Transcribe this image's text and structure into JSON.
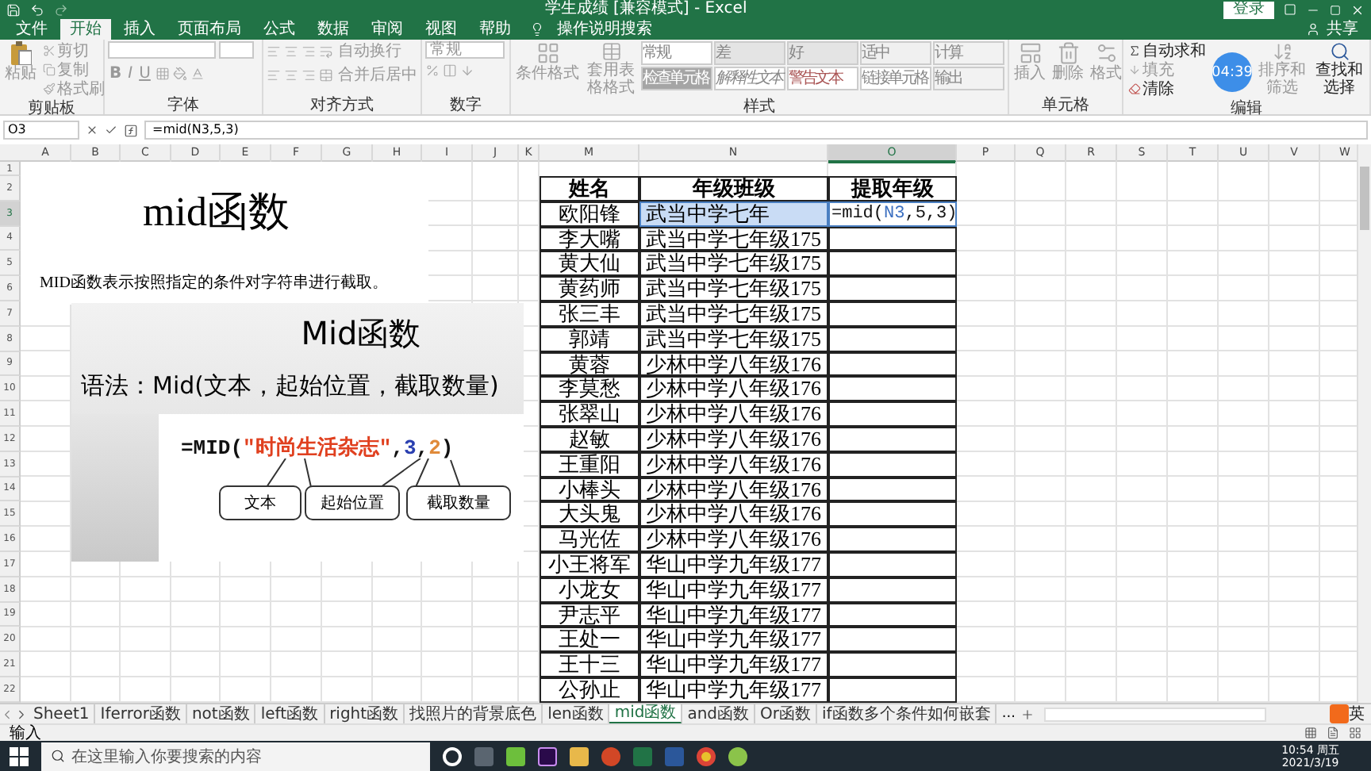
{
  "title_bar": {
    "title": "学生成绩 [兼容模式] - Excel",
    "login_button": "登录"
  },
  "menu_tabs": [
    {
      "label": "文件",
      "selected": false
    },
    {
      "label": "开始",
      "selected": true
    },
    {
      "label": "插入",
      "selected": false
    },
    {
      "label": "页面布局",
      "selected": false
    },
    {
      "label": "公式",
      "selected": false
    },
    {
      "label": "数据",
      "selected": false
    },
    {
      "label": "审阅",
      "selected": false
    },
    {
      "label": "视图",
      "selected": false
    },
    {
      "label": "帮助",
      "selected": false
    }
  ],
  "tell_me": "操作说明搜索",
  "share": "共享",
  "ribbon": {
    "disabled": true,
    "clipboard": {
      "label": "剪贴板",
      "paste": "粘贴",
      "cut": "剪切",
      "copy": "复制",
      "format_painter": "格式刷"
    },
    "font": {
      "label": "字体",
      "bold": "B",
      "italic": "I",
      "underline": "U"
    },
    "alignment": {
      "label": "对齐方式",
      "wrap_text": "自动换行",
      "merge_center": "合并后居中"
    },
    "number": {
      "label": "数字",
      "format": "常规"
    },
    "styles": {
      "label": "样式",
      "conditional": "条件格式",
      "table_format": "套用表格格式",
      "cells": [
        {
          "label": "常规",
          "kind": "normal"
        },
        {
          "label": "差",
          "kind": "bad"
        },
        {
          "label": "好",
          "kind": "good"
        },
        {
          "label": "适中",
          "kind": "neutral"
        },
        {
          "label": "计算",
          "kind": "calc"
        },
        {
          "label": "检查单元格",
          "kind": "check"
        },
        {
          "label": "解释性文本",
          "kind": "explanatory"
        },
        {
          "label": "警告文本",
          "kind": "warning"
        },
        {
          "label": "链接单元格",
          "kind": "linked"
        },
        {
          "label": "输出",
          "kind": "output"
        }
      ]
    },
    "cells": {
      "label": "单元格",
      "insert": "插入",
      "delete": "删除",
      "format": "格式"
    },
    "editing": {
      "label": "编辑",
      "autosum": "自动求和",
      "fill": "填充",
      "clear": "清除",
      "sort_filter": "排序和筛选",
      "find_select": "查找和选择"
    }
  },
  "timer": "04:39",
  "name_box": "O3",
  "formula": "=mid(N3,5,3)",
  "columns": [
    {
      "label": "A",
      "selected": false
    },
    {
      "label": "B",
      "selected": false
    },
    {
      "label": "C",
      "selected": false
    },
    {
      "label": "D",
      "selected": false
    },
    {
      "label": "E",
      "selected": false
    },
    {
      "label": "F",
      "selected": false
    },
    {
      "label": "G",
      "selected": false
    },
    {
      "label": "H",
      "selected": false
    },
    {
      "label": "I",
      "selected": false
    },
    {
      "label": "J",
      "selected": false
    },
    {
      "label": "K",
      "selected": false
    },
    {
      "label": "M",
      "selected": false
    },
    {
      "label": "N",
      "selected": false
    },
    {
      "label": "O",
      "selected": true
    },
    {
      "label": "P",
      "selected": false
    },
    {
      "label": "Q",
      "selected": false
    },
    {
      "label": "R",
      "selected": false
    },
    {
      "label": "S",
      "selected": false
    },
    {
      "label": "T",
      "selected": false
    },
    {
      "label": "U",
      "selected": false
    },
    {
      "label": "V",
      "selected": false
    },
    {
      "label": "W",
      "selected": false
    }
  ],
  "rows": [
    {
      "label": "1",
      "selected": false
    },
    {
      "label": "2",
      "selected": false
    },
    {
      "label": "3",
      "selected": true
    },
    {
      "label": "4",
      "selected": false
    },
    {
      "label": "5",
      "selected": false
    },
    {
      "label": "6",
      "selected": false
    },
    {
      "label": "7",
      "selected": false
    },
    {
      "label": "8",
      "selected": false
    },
    {
      "label": "9",
      "selected": false
    },
    {
      "label": "10",
      "selected": false
    },
    {
      "label": "11",
      "selected": false
    },
    {
      "label": "12",
      "selected": false
    },
    {
      "label": "13",
      "selected": false
    },
    {
      "label": "14",
      "selected": false
    },
    {
      "label": "15",
      "selected": false
    },
    {
      "label": "16",
      "selected": false
    },
    {
      "label": "17",
      "selected": false
    },
    {
      "label": "18",
      "selected": false
    },
    {
      "label": "19",
      "selected": false
    },
    {
      "label": "20",
      "selected": false
    },
    {
      "label": "21",
      "selected": false
    },
    {
      "label": "22",
      "selected": false
    }
  ],
  "textbox": {
    "title": "mid函数",
    "description": "MID函数表示按照指定的条件对字符串进行截取。"
  },
  "slide": {
    "title": "Mid函数",
    "syntax": "语法：Mid(文本，起始位置，截取数量)",
    "formula_parts": [
      {
        "text": "=MID(",
        "color": "#111111"
      },
      {
        "text": "\"时尚生活杂志\"",
        "color": "#e0401f"
      },
      {
        "text": ",",
        "color": "#111111"
      },
      {
        "text": "3",
        "color": "#2a3fb0"
      },
      {
        "text": ",",
        "color": "#111111"
      },
      {
        "text": "2",
        "color": "#e08a3a"
      },
      {
        "text": ")",
        "color": "#111111"
      }
    ],
    "callouts": [
      "文本",
      "起始位置",
      "截取数量"
    ]
  },
  "table": {
    "header": [
      "姓名",
      "年级班级",
      "提取年级"
    ],
    "rows": [
      {
        "name": "欧阳锋",
        "class": "武当中学七年",
        "referenced": true,
        "edit_parts": [
          {
            "text": "=mid(",
            "kind": "plain"
          },
          {
            "text": "N3",
            "kind": "ref"
          },
          {
            "text": ",5,3)",
            "kind": "plain"
          }
        ]
      },
      {
        "name": "李大嘴",
        "class": "武当中学七年级175",
        "referenced": false
      },
      {
        "name": "黄大仙",
        "class": "武当中学七年级175",
        "referenced": false
      },
      {
        "name": "黄药师",
        "class": "武当中学七年级175",
        "referenced": false
      },
      {
        "name": "张三丰",
        "class": "武当中学七年级175",
        "referenced": false
      },
      {
        "name": "郭靖",
        "class": "武当中学七年级175",
        "referenced": false
      },
      {
        "name": "黄蓉",
        "class": "少林中学八年级176",
        "referenced": false
      },
      {
        "name": "李莫愁",
        "class": "少林中学八年级176",
        "referenced": false
      },
      {
        "name": "张翠山",
        "class": "少林中学八年级176",
        "referenced": false
      },
      {
        "name": "赵敏",
        "class": "少林中学八年级176",
        "referenced": false
      },
      {
        "name": "王重阳",
        "class": "少林中学八年级176",
        "referenced": false
      },
      {
        "name": "小棒头",
        "class": "少林中学八年级176",
        "referenced": false
      },
      {
        "name": "大头鬼",
        "class": "少林中学八年级176",
        "referenced": false
      },
      {
        "name": "马光佐",
        "class": "少林中学八年级176",
        "referenced": false
      },
      {
        "name": "小王将军",
        "class": "华山中学九年级177",
        "referenced": false
      },
      {
        "name": "小龙女",
        "class": "华山中学九年级177",
        "referenced": false
      },
      {
        "name": "尹志平",
        "class": "华山中学九年级177",
        "referenced": false
      },
      {
        "name": "王处一",
        "class": "华山中学九年级177",
        "referenced": false
      },
      {
        "name": "王十三",
        "class": "华山中学九年级177",
        "referenced": false
      },
      {
        "name": "公孙止",
        "class": "华山中学九年级177",
        "referenced": false
      }
    ]
  },
  "sheet_tabs": [
    {
      "label": "Sheet1",
      "selected": false
    },
    {
      "label": "Iferror函数",
      "selected": false
    },
    {
      "label": "not函数",
      "selected": false
    },
    {
      "label": "left函数",
      "selected": false
    },
    {
      "label": "right函数",
      "selected": false
    },
    {
      "label": "找照片的背景底色",
      "selected": false
    },
    {
      "label": "len函数",
      "selected": false
    },
    {
      "label": "mid函数",
      "selected": true
    },
    {
      "label": "and函数",
      "selected": false
    },
    {
      "label": "Or函数",
      "selected": false
    },
    {
      "label": "if函数多个条件如何嵌套",
      "selected": false
    }
  ],
  "more_tabs": "...",
  "ime": "英",
  "status": "输入",
  "taskbar": {
    "search_placeholder": "在这里输入你要搜索的内容",
    "time": "10:54 周五",
    "date": "2021/3/19"
  }
}
